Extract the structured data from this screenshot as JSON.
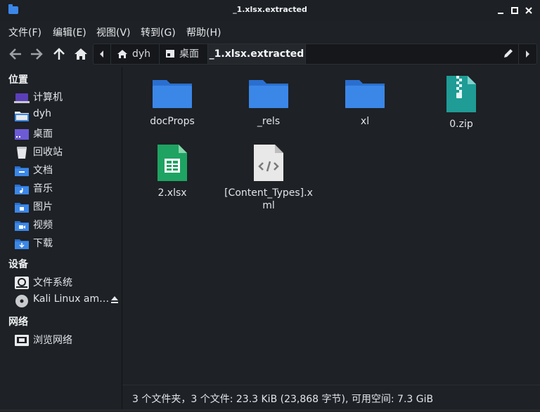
{
  "window": {
    "title": "_1.xlsx.extracted"
  },
  "menu": [
    "文件(F)",
    "编辑(E)",
    "视图(V)",
    "转到(G)",
    "帮助(H)"
  ],
  "pathbar": {
    "crumbs": [
      "dyh",
      "桌面",
      "_1.xlsx.extracted"
    ]
  },
  "sidebar": {
    "sections": [
      {
        "heading": "位置"
      },
      {
        "heading": "设备"
      },
      {
        "heading": "网络"
      }
    ],
    "places": [
      {
        "label": "计算机",
        "icon": "computer-icon"
      },
      {
        "label": "dyh",
        "icon": "home-folder-icon"
      },
      {
        "label": "桌面",
        "icon": "desktop-folder-icon"
      },
      {
        "label": "回收站",
        "icon": "trash-icon"
      },
      {
        "label": "文档",
        "icon": "documents-folder-icon"
      },
      {
        "label": "音乐",
        "icon": "music-folder-icon"
      },
      {
        "label": "图片",
        "icon": "pictures-folder-icon"
      },
      {
        "label": "视频",
        "icon": "videos-folder-icon"
      },
      {
        "label": "下载",
        "icon": "downloads-folder-icon"
      }
    ],
    "devices": [
      {
        "label": "文件系统",
        "icon": "harddisk-icon"
      },
      {
        "label": "Kali Linux am…",
        "icon": "optical-disc-icon"
      }
    ],
    "network": [
      {
        "label": "浏览网络",
        "icon": "network-icon"
      }
    ]
  },
  "files": [
    {
      "name": "docProps",
      "type": "folder"
    },
    {
      "name": "_rels",
      "type": "folder"
    },
    {
      "name": "xl",
      "type": "folder"
    },
    {
      "name": "0.zip",
      "type": "zip"
    },
    {
      "name": "2.xlsx",
      "type": "spreadsheet"
    },
    {
      "name": "[Content_Types].xml",
      "type": "xml"
    }
  ],
  "status": "3 个文件夹，3 个文件: 23.3 KiB (23,868 字节), 可用空间: 7.3 GiB",
  "colors": {
    "background": "#1e2125",
    "folder": "#3b87e8",
    "zip": "#1e9c95",
    "spreadsheet": "#1ea362",
    "xml": "#e8e8e8"
  }
}
